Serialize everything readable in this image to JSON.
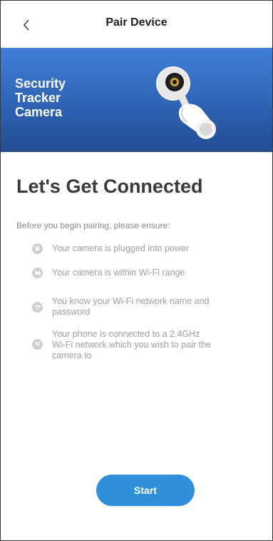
{
  "header": {
    "back_icon": "chevron-left-icon",
    "title": "Pair Device"
  },
  "banner": {
    "title_lines": [
      "Security",
      "Tracker",
      "Camera"
    ],
    "illustration": "security-camera-icon"
  },
  "main": {
    "title": "Let's Get Connected",
    "intro": "Before you begin pairing, please ensure:",
    "checklist": [
      {
        "icon": "plug-icon",
        "lines": [
          "Your camera is plugged into power"
        ]
      },
      {
        "icon": "wifi-router-icon",
        "lines": [
          "Your camera is within Wi-Fi range"
        ]
      },
      {
        "icon": "wifi-icon",
        "lines": [
          "You know your Wi-Fi network name and",
          "password"
        ]
      },
      {
        "icon": "wifi-icon",
        "lines": [
          "Your phone is connected to a 2.4GHz",
          "Wi-Fi network which you wish to pair the",
          "camera to"
        ]
      }
    ]
  },
  "start_button": {
    "label": "Start"
  },
  "colors": {
    "banner_top": "#3f7fd9",
    "banner_bottom": "#234d93",
    "accent": "#2f8fd8"
  }
}
